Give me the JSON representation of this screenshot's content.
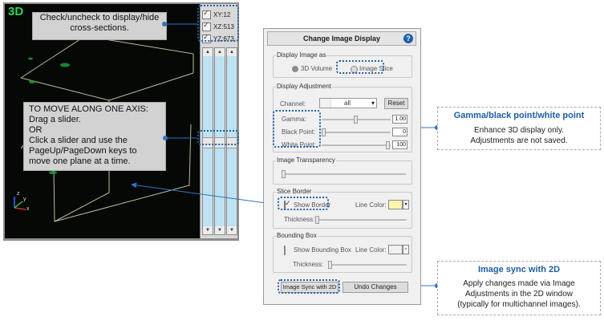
{
  "viewer": {
    "mode_label": "3D",
    "axis_labels": {
      "x": "x",
      "y": "y",
      "z": "z"
    },
    "cross_sections": [
      {
        "label": "XY:12",
        "checked": true
      },
      {
        "label": "XZ:513",
        "checked": true
      },
      {
        "label": "YZ:673",
        "checked": true
      }
    ],
    "scroll_arrows": {
      "up": "▲",
      "down": "▼"
    }
  },
  "callouts": {
    "cross_sections": [
      "Check/uncheck to display/hide",
      "cross-sections."
    ],
    "move_axis": [
      "TO MOVE ALONG ONE AXIS:",
      "Drag a slider.",
      "OR",
      "Click a slider and use the",
      "PageUp/PageDown keys to",
      "move one plane at a time."
    ]
  },
  "dialog": {
    "title": "Change Image Display",
    "help_glyph": "?",
    "display_image_as": {
      "group_label": "Display Image as",
      "options": [
        "3D Volume",
        "Image Slice"
      ]
    },
    "display_adjustment": {
      "group_label": "Display Adjustment",
      "channel_label": "Channel:",
      "channel_value": "all",
      "dropdown_arrow": "▾",
      "reset_label": "Reset",
      "gamma_label": "Gamma:",
      "gamma_value": "1.00",
      "black_point_label": "Black Point:",
      "black_point_value": "0",
      "white_point_label": "White Point:",
      "white_point_value": "100"
    },
    "image_transparency": {
      "group_label": "Image Transparency"
    },
    "slice_border": {
      "group_label": "Slice Border",
      "show_border_label": "Show Border",
      "show_border_checked": true,
      "line_color_label": "Line Color:",
      "line_color": "#fff5b0",
      "thickness_label": "Thickness:"
    },
    "bounding_box": {
      "group_label": "Bounding Box",
      "show_label": "Show Bounding Box",
      "show_checked": false,
      "line_color_label": "Line Color:",
      "line_color": "#f0f0f0",
      "thickness_label": "Thickness:"
    },
    "buttons": {
      "sync": "Image Sync with 2D",
      "undo": "Undo Changes"
    }
  },
  "info_boxes": {
    "gamma": {
      "title": "Gamma/black point/white point",
      "lines": [
        "Enhance 3D display only.",
        "Adjustments are not saved."
      ]
    },
    "sync": {
      "title": "Image sync with 2D",
      "lines": [
        "Apply changes made via Image",
        "Adjustments in the 2D window",
        "(typically for multichannel images)."
      ]
    }
  },
  "colors": {
    "accent": "#1d5fa8",
    "scroll_track": "#bfe2f2",
    "label_3d": "#2fd35a"
  }
}
